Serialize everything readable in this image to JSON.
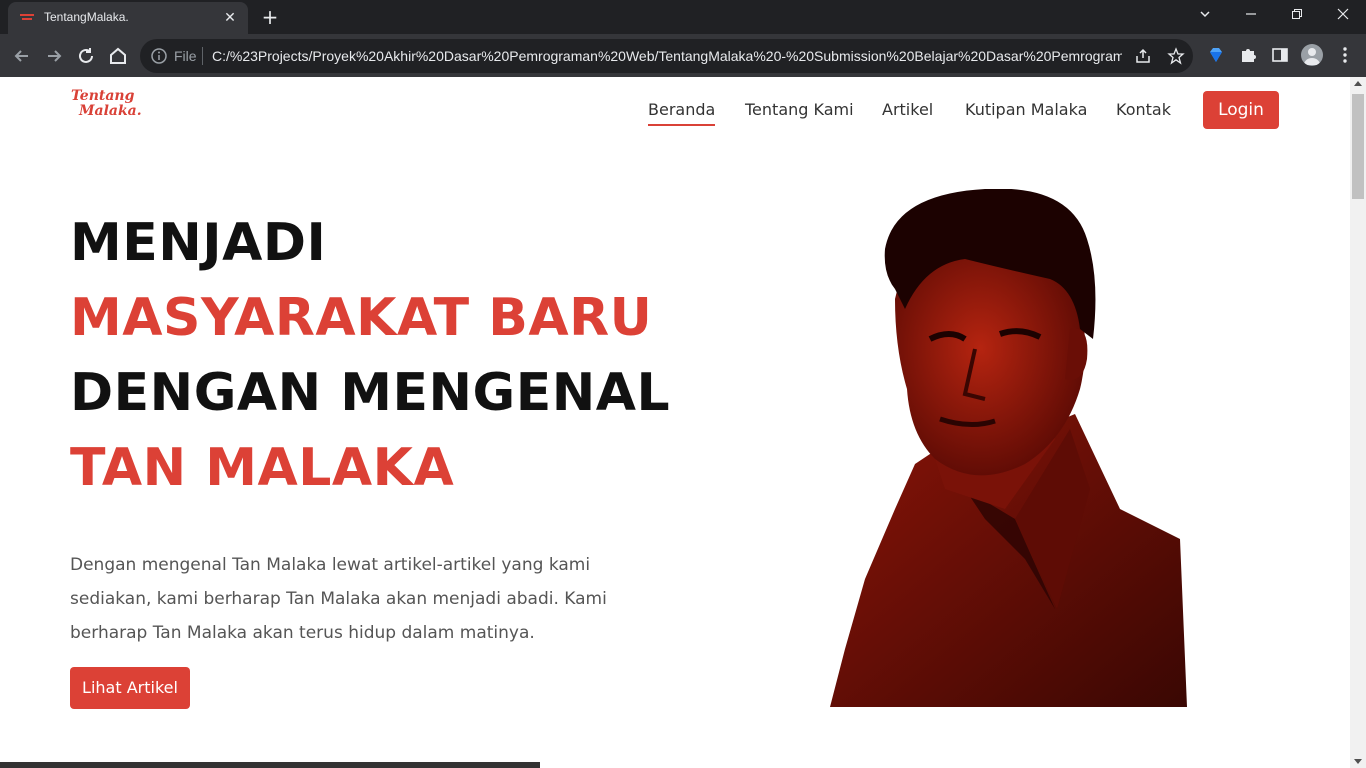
{
  "browser": {
    "tab_title": "TentangMalaka.",
    "close_glyph": "✕",
    "new_tab_glyph": "+",
    "omnibox_scheme": "File",
    "url": "C:/%23Projects/Proyek%20Akhir%20Dasar%20Pemrograman%20Web/TentangMalaka%20-%20Submission%20Belajar%20Dasar%20Pemrograman...",
    "window_controls": [
      "chevron-down-icon",
      "minimize-icon",
      "restore-icon",
      "close-icon"
    ]
  },
  "site": {
    "logo_line1": "Tentang",
    "logo_line2": "Malaka.",
    "brand_color": "#dc4136"
  },
  "nav": {
    "items": [
      {
        "label": "Beranda",
        "active": true
      },
      {
        "label": "Tentang Kami"
      },
      {
        "label": "Artikel"
      },
      {
        "label": "Kutipan Malaka"
      },
      {
        "label": "Kontak"
      }
    ],
    "login_label": "Login"
  },
  "hero": {
    "line1": "MENJADI",
    "line2": "MASYARAKAT BARU",
    "line3": "DENGAN MENGENAL",
    "line4": "TAN MALAKA",
    "description": "Dengan mengenal Tan Malaka lewat artikel-artikel yang kami sediakan, kami berharap Tan Malaka akan menjadi abadi. Kami berharap Tan Malaka akan terus hidup dalam matinya.",
    "cta_label": "Lihat Artikel"
  }
}
